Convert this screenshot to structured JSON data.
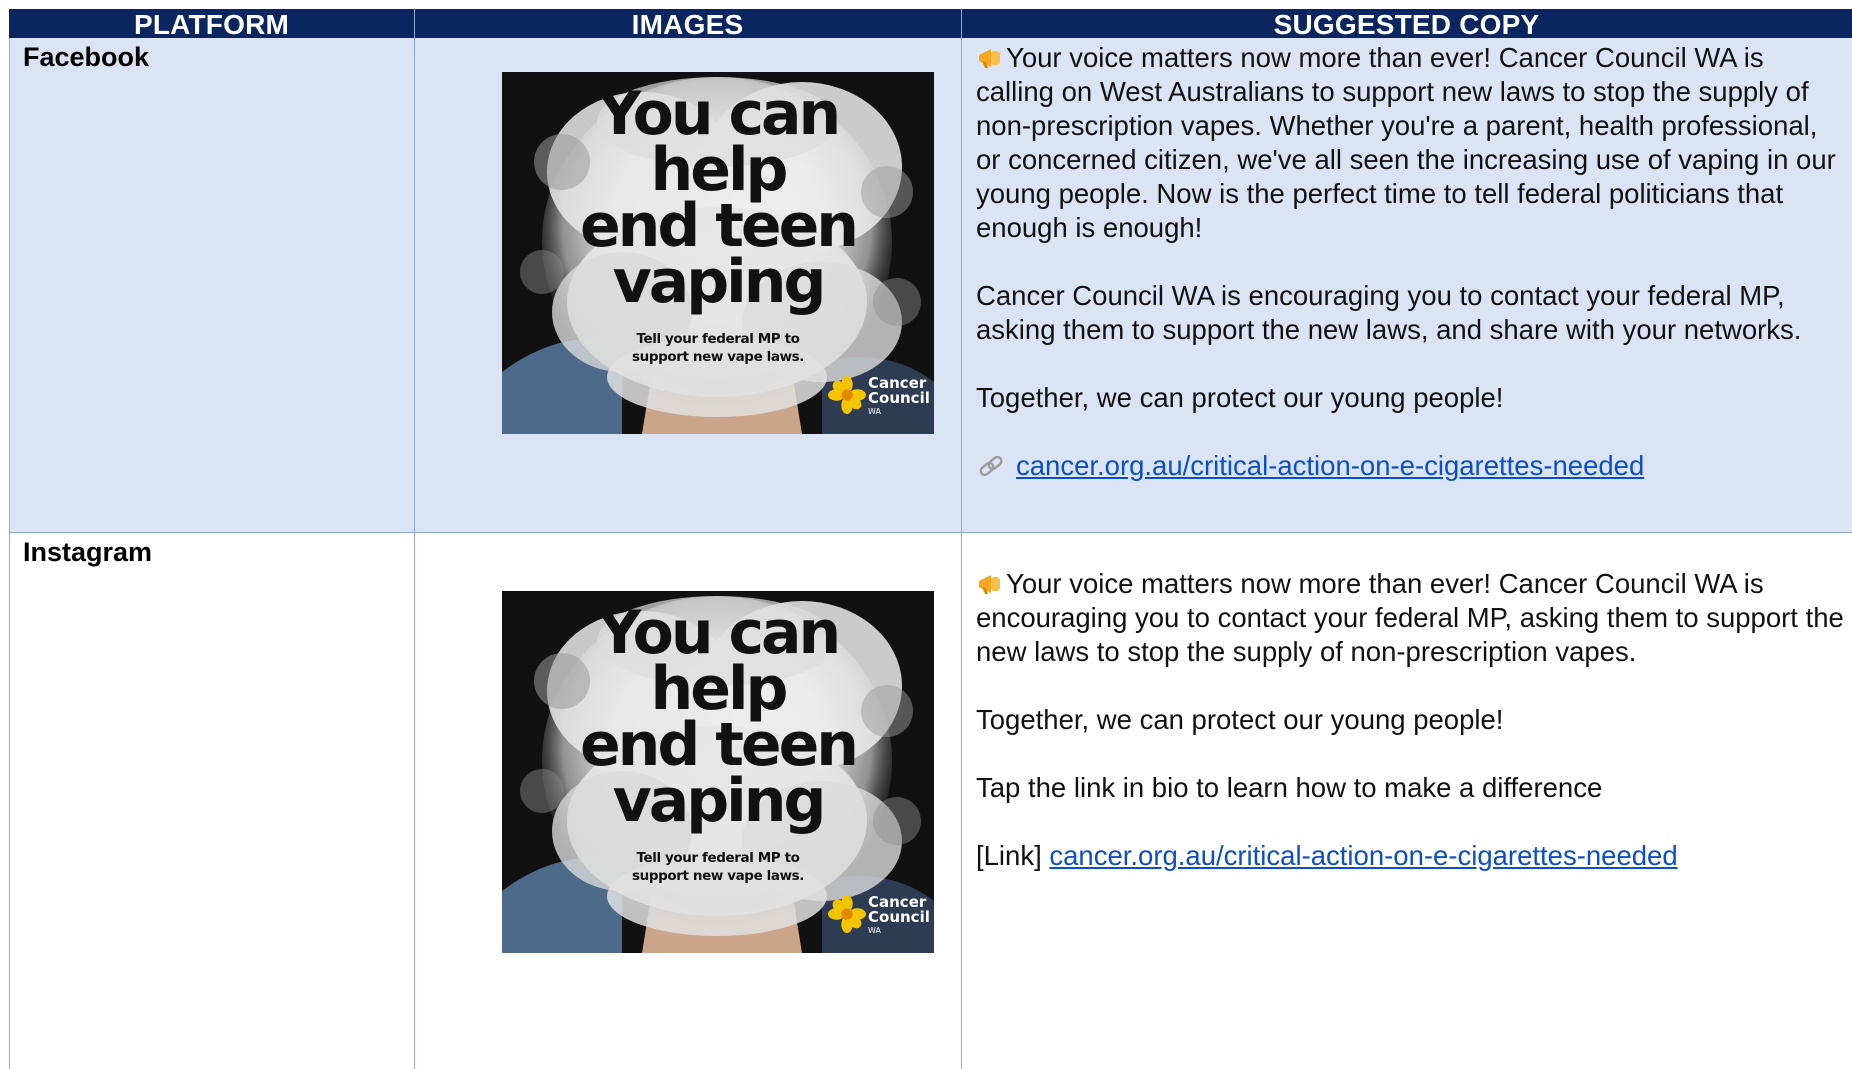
{
  "header": {
    "platform": "PLATFORM",
    "images": "IMAGES",
    "copy": "SUGGESTED COPY"
  },
  "rows": [
    {
      "platform": "Facebook",
      "poster": {
        "headline": [
          "You can",
          "help",
          "end teen",
          "vaping"
        ],
        "subline": [
          "Tell your federal MP to",
          "support new vape laws."
        ],
        "logo": [
          "Cancer",
          "Council",
          "WA"
        ]
      },
      "copy": {
        "p1": "Your voice matters now more than ever! Cancer Council WA is calling on West Australians to support new laws to stop the supply of non-prescription vapes. Whether you're a parent, health professional, or concerned citizen, we've all seen the increasing use of vaping in our young people. Now is the perfect time to tell federal politicians that enough is enough!",
        "p2": "Cancer Council WA is encouraging you to contact your federal MP, asking them to support the new laws, and share with your networks.",
        "p3": "Together, we can protect our young people!",
        "link_prefix": "",
        "link": "cancer.org.au/critical-action-on-e-cigarettes-needed"
      }
    },
    {
      "platform": "Instagram",
      "poster": {
        "headline": [
          "You can",
          "help",
          "end teen",
          "vaping"
        ],
        "subline": [
          "Tell your federal MP to",
          "support new vape laws."
        ],
        "logo": [
          "Cancer",
          "Council",
          "WA"
        ]
      },
      "copy": {
        "p1": "Your voice matters now more than ever! Cancer Council WA is encouraging you to contact your federal MP, asking them to support the new laws to stop the supply of non-prescription vapes.",
        "p2": "Together, we can protect our young people!",
        "p3": "Tap the link in bio to learn how to make a difference",
        "link_prefix": "[Link]",
        "link": "cancer.org.au/critical-action-on-e-cigarettes-needed"
      }
    }
  ],
  "icons": {
    "megaphone": "megaphone-icon",
    "link": "link-icon"
  },
  "colors": {
    "header_bg": "#0b2560",
    "row_shade": "#dbe4f4",
    "border": "#8fa7d3",
    "link": "#0b4fc7",
    "logo_yellow": "#f5c400"
  }
}
